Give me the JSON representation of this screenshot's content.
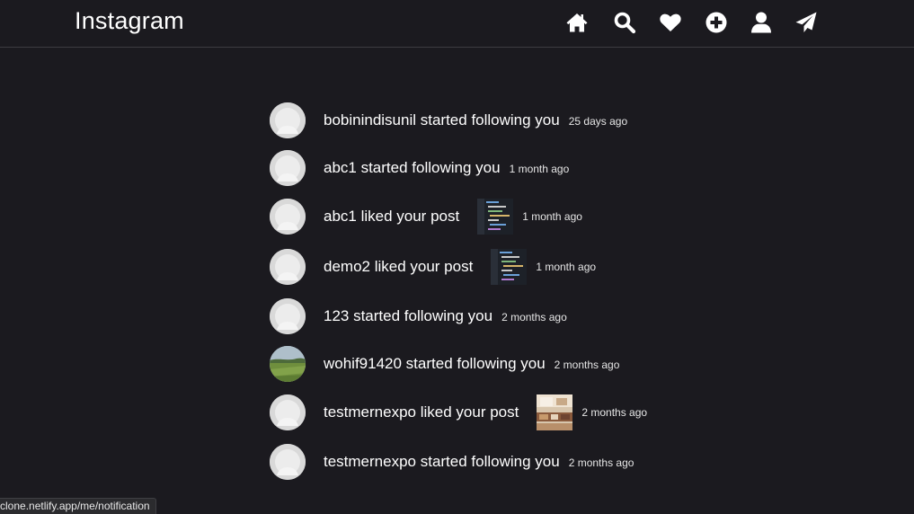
{
  "header": {
    "brand": "Instagram",
    "nav": [
      {
        "name": "home-icon"
      },
      {
        "name": "search-icon"
      },
      {
        "name": "heart-icon"
      },
      {
        "name": "plus-circle-icon"
      },
      {
        "name": "user-icon"
      },
      {
        "name": "paper-plane-icon"
      }
    ]
  },
  "notifications": [
    {
      "message": "bobinindisunil started following you",
      "time": "25 days ago",
      "avatar": "default",
      "thumbnail": null
    },
    {
      "message": "abc1 started following you",
      "time": "1 month ago",
      "avatar": "default",
      "thumbnail": null
    },
    {
      "message": "abc1 liked your post",
      "time": "1 month ago",
      "avatar": "default",
      "thumbnail": "code-screenshot"
    },
    {
      "message": "demo2 liked your post",
      "time": "1 month ago",
      "avatar": "default",
      "thumbnail": "code-screenshot"
    },
    {
      "message": "123 started following you",
      "time": "2 months ago",
      "avatar": "default",
      "thumbnail": null
    },
    {
      "message": "wohif91420 started following you",
      "time": "2 months ago",
      "avatar": "landscape-photo",
      "thumbnail": null
    },
    {
      "message": "testmernexpo liked your post",
      "time": "2 months ago",
      "avatar": "default",
      "thumbnail": "room-photo"
    },
    {
      "message": "testmernexpo started following you",
      "time": "2 months ago",
      "avatar": "default",
      "thumbnail": null
    }
  ],
  "status_bar": {
    "url": "clone.netlify.app/me/notification"
  },
  "colors": {
    "background": "#1b1a1f",
    "text": "#ffffff",
    "divider": "#3d3c41",
    "avatar_default": "#d9d9d9"
  }
}
